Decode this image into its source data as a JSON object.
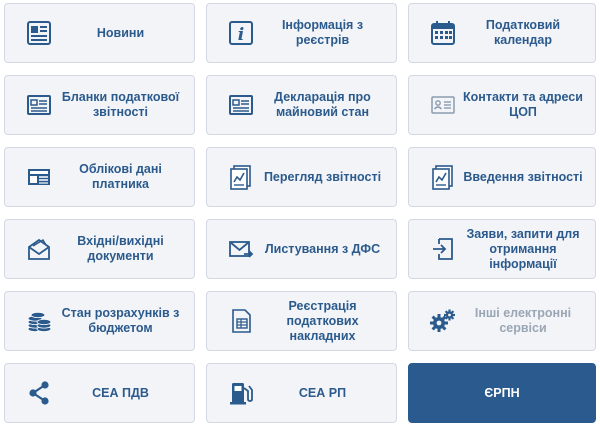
{
  "colors": {
    "accent": "#2a5a8e",
    "tile_bg": "#f3f4f8",
    "tile_border": "#d4d8e4",
    "text": "#2b5a8c",
    "disabled_text": "#9aa6b5"
  },
  "tiles": [
    {
      "label": "Новини",
      "icon": "newspaper-icon"
    },
    {
      "label": "Інформація з реєстрів",
      "icon": "info-icon"
    },
    {
      "label": "Податковий календар",
      "icon": "calendar-icon"
    },
    {
      "label": "Бланки податкової звітності",
      "icon": "forms-icon"
    },
    {
      "label": "Декларація про майновий стан",
      "icon": "declaration-icon"
    },
    {
      "label": "Контакти та адреси ЦОП",
      "icon": "contacts-card-icon"
    },
    {
      "label": "Облікові дані платника",
      "icon": "taxpayer-data-icon"
    },
    {
      "label": "Перегляд звітності",
      "icon": "view-reports-icon"
    },
    {
      "label": "Введення звітності",
      "icon": "enter-reports-icon"
    },
    {
      "label": "Вхідні/вихідні документи",
      "icon": "envelope-documents-icon"
    },
    {
      "label": "Листування з ДФС",
      "icon": "send-mail-icon"
    },
    {
      "label": "Заяви, запити для отримання інформації",
      "icon": "request-icon"
    },
    {
      "label": "Стан розрахунків з бюджетом",
      "icon": "coins-icon"
    },
    {
      "label": "Реєстрація податкових накладних",
      "icon": "invoice-register-icon"
    },
    {
      "label": "Інші електронні сервіси",
      "icon": "gears-icon"
    },
    {
      "label": "СЕА ПДВ",
      "icon": "share-icon"
    },
    {
      "label": "СЕА РП",
      "icon": "fuel-pump-icon"
    },
    {
      "label": "ЄРПН",
      "icon": ""
    }
  ]
}
